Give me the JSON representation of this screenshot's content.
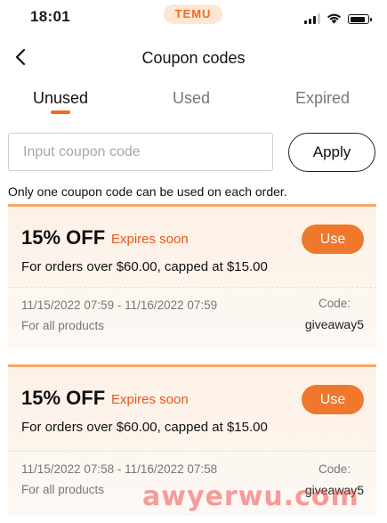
{
  "status_bar": {
    "time": "18:01",
    "brand": "TEMU"
  },
  "header": {
    "title": "Coupon codes"
  },
  "tabs": [
    {
      "label": "Unused",
      "active": true
    },
    {
      "label": "Used",
      "active": false
    },
    {
      "label": "Expired",
      "active": false
    }
  ],
  "coupon_entry": {
    "placeholder": "Input coupon code",
    "value": "",
    "apply_label": "Apply"
  },
  "notice": "Only one coupon code can be used on each order.",
  "coupons": [
    {
      "discount": "15% OFF",
      "status": "Expires soon",
      "use_label": "Use",
      "condition": "For orders over $60.00, capped at $15.00",
      "valid_range": "11/15/2022 07:59 - 11/16/2022 07:59",
      "scope": "For all products",
      "code_label": "Code:",
      "code": "giveaway5"
    },
    {
      "discount": "15% OFF",
      "status": "Expires soon",
      "use_label": "Use",
      "condition": "For orders over $60.00, capped at $15.00",
      "valid_range": "11/15/2022 07:58 - 11/16/2022 07:58",
      "scope": "For all products",
      "code_label": "Code:",
      "code": "giveaway5"
    }
  ],
  "watermark": "awyerwu.com",
  "colors": {
    "accent": "#f26b1d",
    "use_button": "#f0782c",
    "expires_text": "#e8561f",
    "card_background": "#fdf1e6",
    "card_top_border": "#f5a86a"
  },
  "icons": {
    "back": "chevron-left-icon",
    "signal": "cellular-signal-icon",
    "wifi": "wifi-icon",
    "battery": "battery-icon"
  }
}
